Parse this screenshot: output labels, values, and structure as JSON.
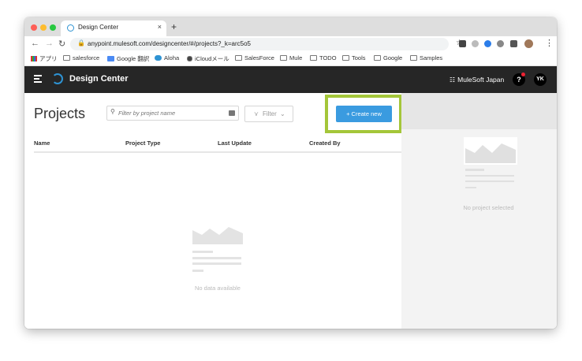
{
  "browser": {
    "tab_title": "Design Center",
    "tab_close": "×",
    "new_tab": "+",
    "url": "anypoint.mulesoft.com/designcenter/#/projects?_k=arc5o5",
    "bookmarks": [
      "アプリ",
      "salesforce",
      "Google 翻訳",
      "Aloha",
      "iCloudメール",
      "SalesForce",
      "Mule",
      "TODO",
      "Tools",
      "Google",
      "Samples"
    ]
  },
  "header": {
    "app_name": "Design Center",
    "org_name": "MuleSoft Japan",
    "help_label": "?",
    "avatar_initials": "YK"
  },
  "main": {
    "title": "Projects",
    "search_placeholder": "Filter by project name",
    "filter_label": "Filter",
    "create_label": "+ Create new",
    "columns": [
      "Name",
      "Project Type",
      "Last Update",
      "Created By"
    ],
    "empty_text": "No data available"
  },
  "side_panel": {
    "empty_text": "No project selected"
  },
  "colors": {
    "header_bg": "#262626",
    "accent": "#3a9be0",
    "highlight": "#a4c639"
  }
}
